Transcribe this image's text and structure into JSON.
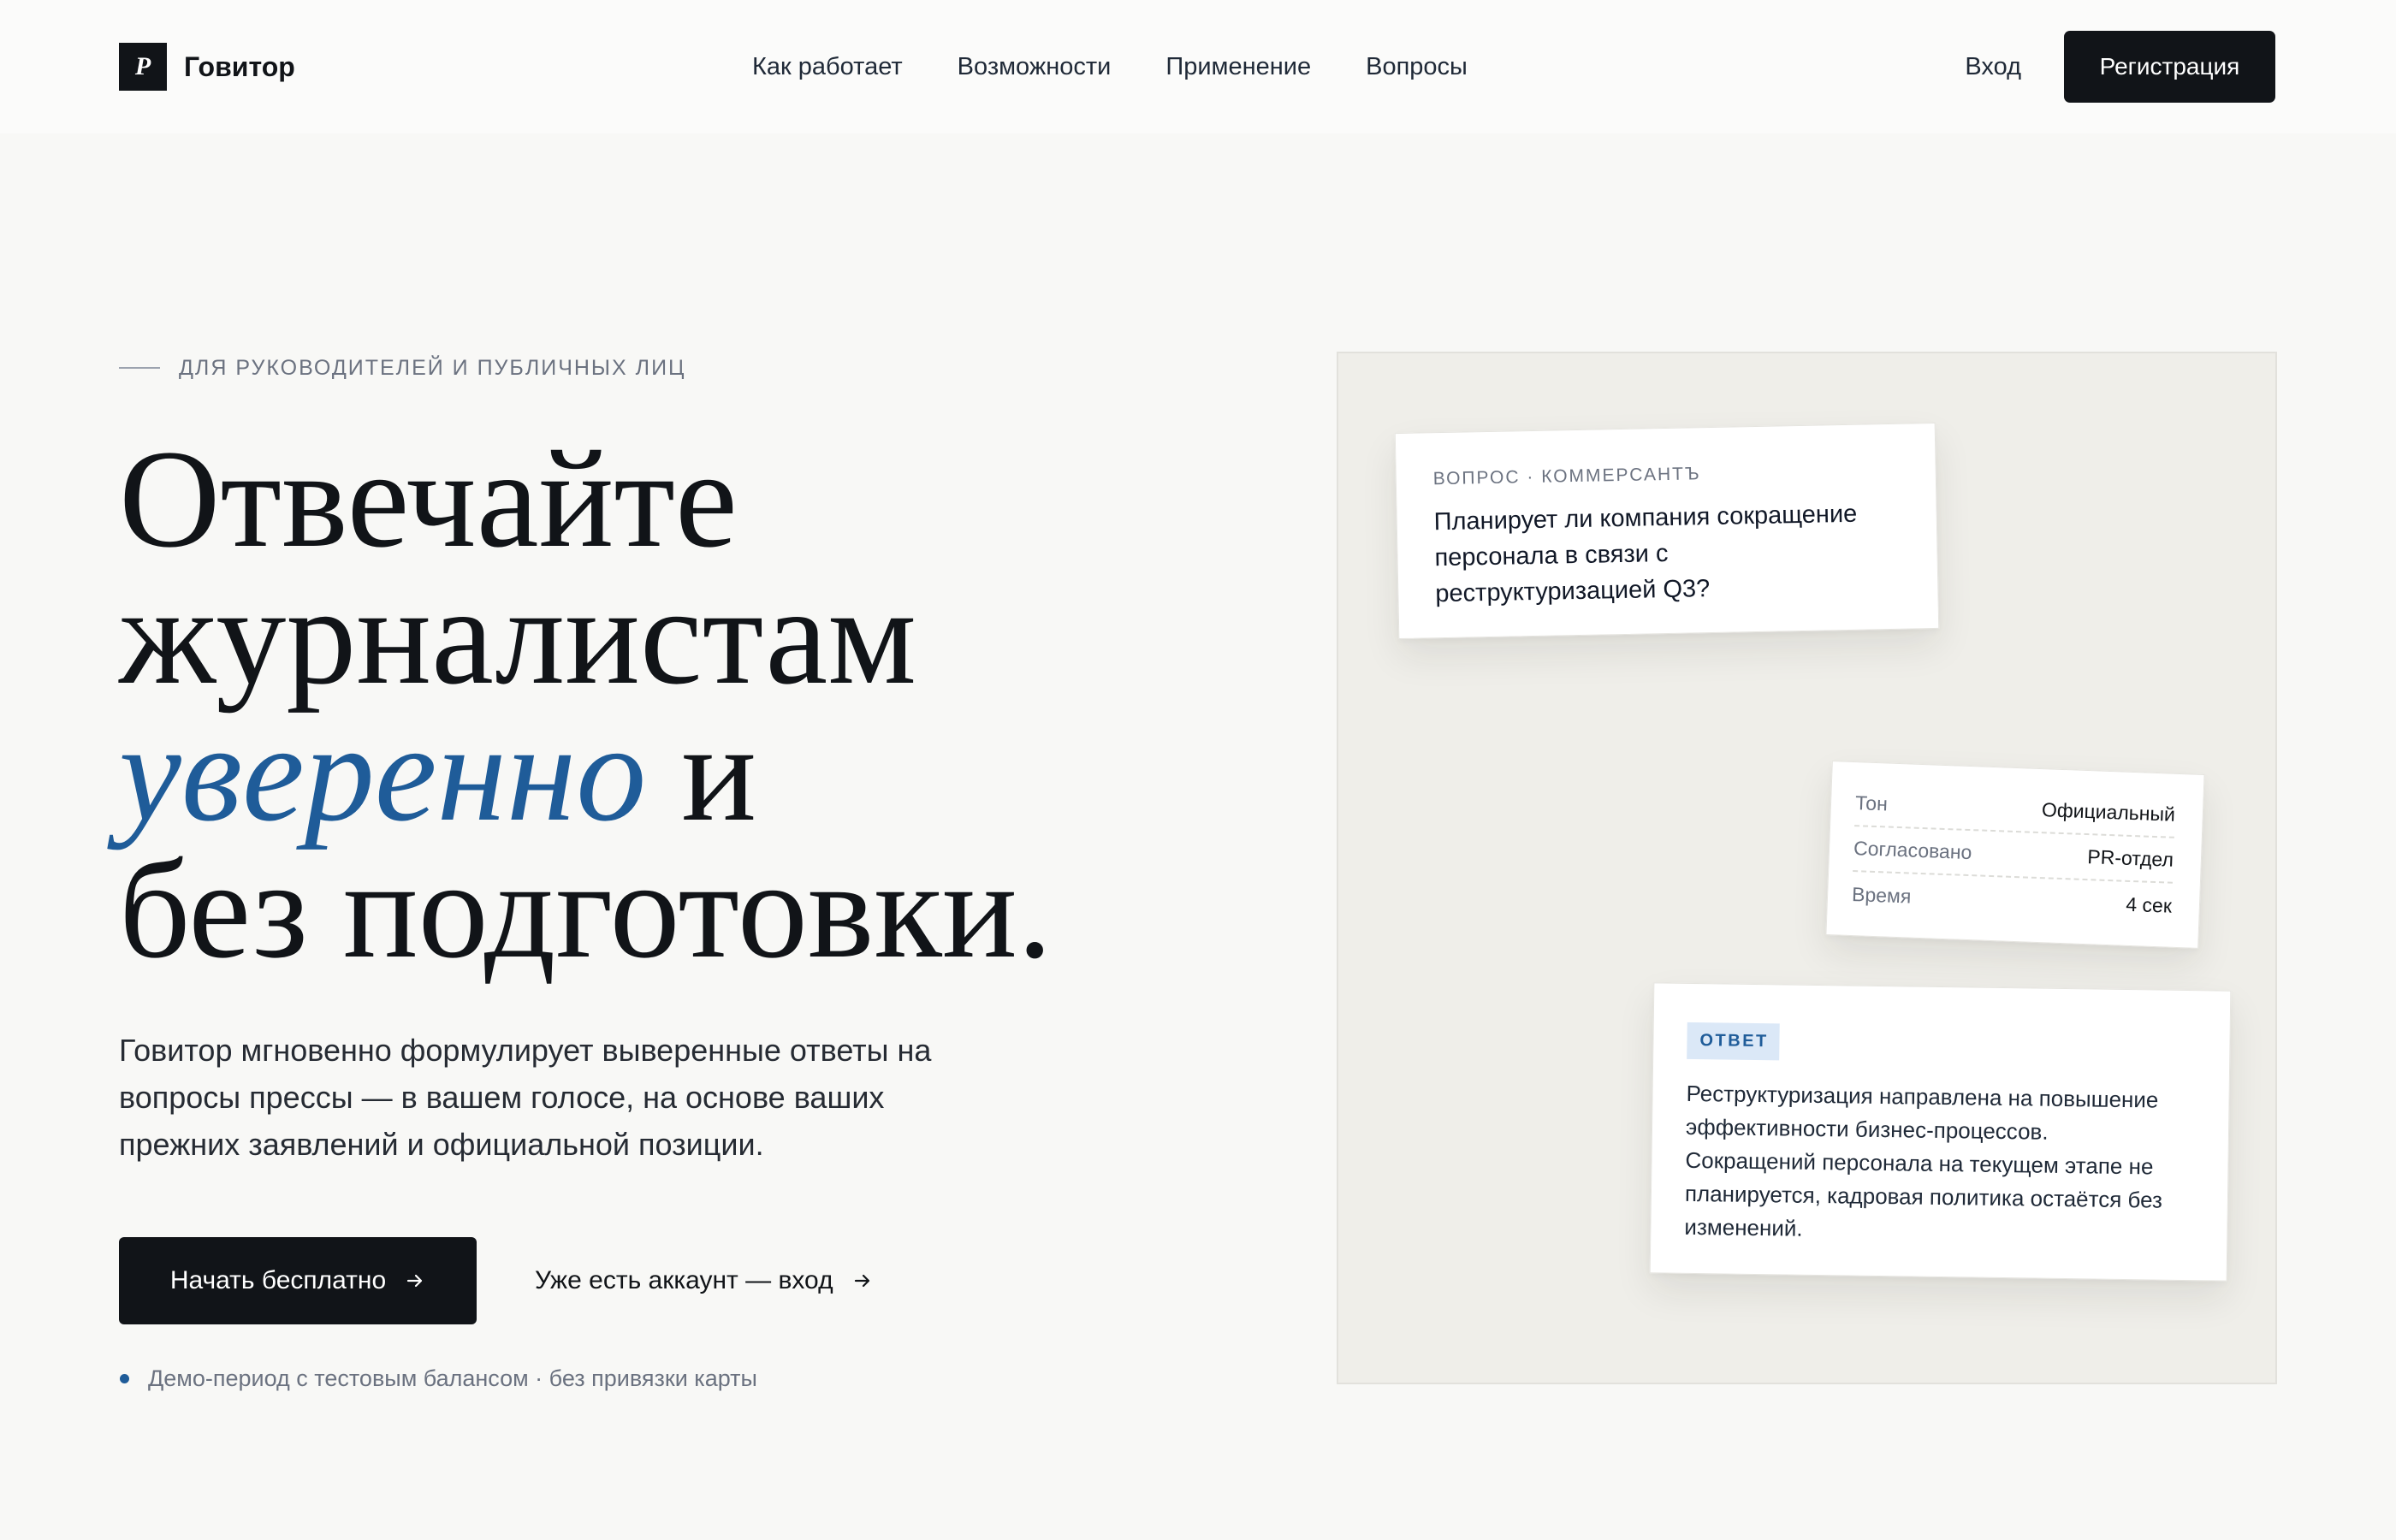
{
  "header": {
    "logo_glyph": "P",
    "brand": "Говитор",
    "nav": [
      "Как работает",
      "Возможности",
      "Применение",
      "Вопросы"
    ],
    "login": "Вход",
    "register": "Регистрация"
  },
  "hero": {
    "eyebrow": "ДЛЯ РУКОВОДИТЕЛЕЙ И ПУБЛИЧНЫХ ЛИЦ",
    "title_line_1": "Отвечайте",
    "title_line_2": "журналистам",
    "title_accent": "уверенно",
    "title_line_3_rest": "и",
    "title_line_4": "без подготовки.",
    "description": "Говитор мгновенно формулирует выверенные ответы на вопросы прессы — в вашем голосе, на основе ваших прежних заявлений и официальной позиции.",
    "cta_primary": "Начать бесплатно",
    "cta_secondary": "Уже есть аккаунт — вход",
    "note": "Демо-период с тестовым балансом · без привязки карты"
  },
  "preview": {
    "question": {
      "label": "ВОПРОС · КОММЕРСАНТЪ",
      "text": "Планирует ли компания сокращение персонала в связи с реструктуризацией Q3?"
    },
    "meta": [
      {
        "label": "Тон",
        "value": "Официальный"
      },
      {
        "label": "Согласовано",
        "value": "PR-отдел"
      },
      {
        "label": "Время",
        "value": "4 сек"
      }
    ],
    "answer": {
      "badge": "ОТВЕТ",
      "sentences": [
        "Реструктуризация направлена на повышение эффективности бизнес-процессов.",
        "Сокращений персонала на текущем этапе не планируется, кадровая политика остаётся без изменений."
      ]
    }
  },
  "icons": {
    "cta_primary_icon": "arrow-right",
    "cta_secondary_icon": "arrow-right",
    "note_icon": "dot"
  },
  "colors": {
    "accent": "#1f5c99",
    "dark": "#111418",
    "background": "#f8f8f6",
    "panel": "#efeee9",
    "badge_bg": "#dbe8f7"
  }
}
